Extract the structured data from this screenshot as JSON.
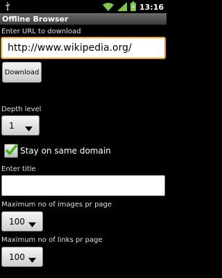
{
  "status_bar": {
    "time": "13:16",
    "icons": [
      "usb-icon",
      "wifi-icon",
      "signal-icon",
      "battery-icon"
    ]
  },
  "app": {
    "title": "Offline Browser"
  },
  "form": {
    "url_label": "Enter URL to download",
    "url_value": "http://www.wikipedia.org/",
    "download_label": "Download",
    "depth_label": "Depth level",
    "depth_value": "1",
    "same_domain_label": "Stay on same domain",
    "same_domain_checked": true,
    "title_label": "Enter title",
    "title_value": "",
    "max_images_label": "Maximum no of images pr page",
    "max_images_value": "100",
    "max_links_label": "Maximum no of links pr page",
    "max_links_value": "100"
  },
  "colors": {
    "accent": "#f7a21a",
    "check": "#43b514",
    "wifi": "#7ec94c"
  }
}
